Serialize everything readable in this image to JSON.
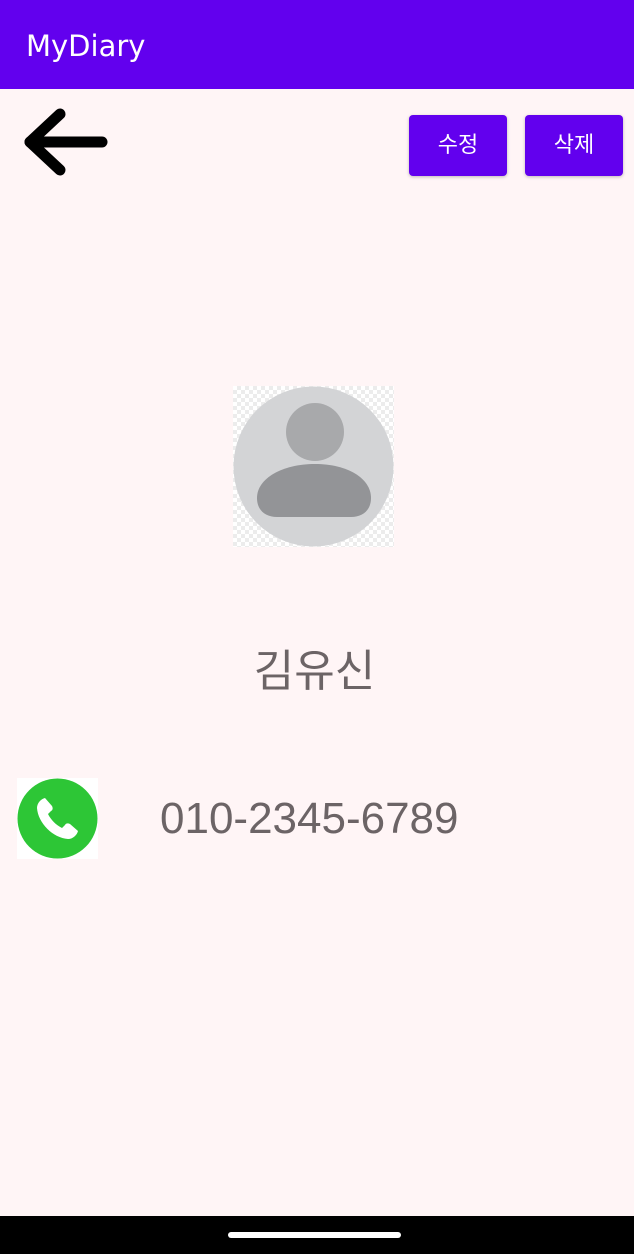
{
  "app": {
    "title": "MyDiary"
  },
  "toolbar": {
    "back_icon": "arrow-left-icon",
    "edit_label": "수정",
    "delete_label": "삭제"
  },
  "contact": {
    "avatar_icon": "person-placeholder-icon",
    "name": "김유신",
    "phone": "010-2345-6789",
    "call_icon": "phone-call-icon"
  },
  "colors": {
    "accent": "#6200ee",
    "background": "#fff5f6",
    "text_secondary": "#6c6466",
    "call_green": "#2dc636"
  }
}
